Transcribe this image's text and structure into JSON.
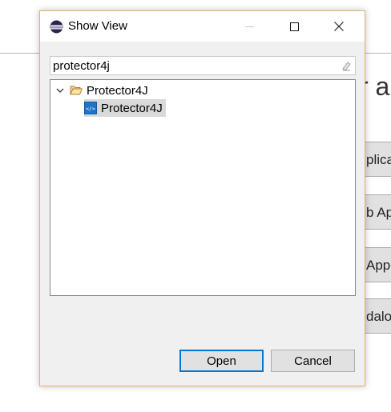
{
  "background": {
    "heading_fragment": "r ap",
    "buttons": [
      "plica",
      "b Ap",
      "App",
      "dalo"
    ]
  },
  "dialog": {
    "title": "Show View",
    "icon": "eclipse-icon",
    "window_controls": {
      "minimize": "—",
      "maximize": "☐",
      "close": "✕"
    },
    "filter": {
      "value": "protector4j",
      "clear_icon": "eraser-icon"
    },
    "tree": {
      "folder": {
        "label": "Protector4J",
        "expanded": true,
        "icon": "folder-open-icon"
      },
      "items": [
        {
          "label": "Protector4J",
          "icon": "view-icon",
          "selected": true
        }
      ]
    },
    "buttons": {
      "open": "Open",
      "cancel": "Cancel"
    }
  },
  "colors": {
    "dialog_border": "#e0b26f",
    "dialog_bg": "#f0f0f0",
    "default_button_border": "#0078d7",
    "selection_bg": "#d9d9d9"
  }
}
